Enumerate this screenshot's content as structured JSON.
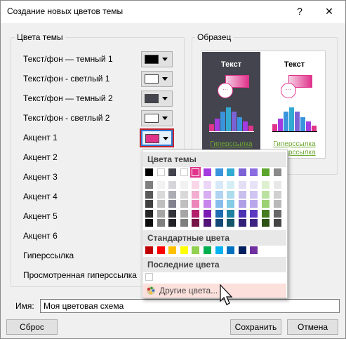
{
  "dialog": {
    "title": "Создание новых цветов темы",
    "help_label": "?",
    "close_label": "✕"
  },
  "theme_group": {
    "legend": "Цвета темы",
    "rows": [
      {
        "label": "Текст/фон — темный 1",
        "color": "#000000"
      },
      {
        "label": "Текст/фон - светлый 1",
        "color": "#ffffff"
      },
      {
        "label": "Текст/фон — темный 2",
        "color": "#44444f"
      },
      {
        "label": "Текст/фон - светлый 2",
        "color": "#ffffff"
      },
      {
        "label": "Акцент 1",
        "color": "#e0338c"
      },
      {
        "label": "Акцент 2",
        "color": null
      },
      {
        "label": "Акцент 3",
        "color": null
      },
      {
        "label": "Акцент 4",
        "color": null
      },
      {
        "label": "Акцент 5",
        "color": null
      },
      {
        "label": "Акцент 6",
        "color": null
      },
      {
        "label": "Гиперссылка",
        "color": null
      },
      {
        "label": "Просмотренная гиперссылка",
        "color": null
      }
    ]
  },
  "sample_group": {
    "legend": "Образец",
    "samples": [
      {
        "theme": "dark",
        "text": "Текст",
        "link": "Гиперссылка",
        "link2": "",
        "bg": "#44444f",
        "fg": "#ffffff"
      },
      {
        "theme": "light",
        "text": "Текст",
        "link": "Гиперссылка",
        "link2": "Гиперссылка",
        "bg": "#ffffff",
        "fg": "#000000"
      }
    ]
  },
  "color_menu": {
    "theme_header": "Цвета темы",
    "theme_top": [
      "#000000",
      "#ffffff",
      "#44444f",
      "#ffffff",
      "#e0338c",
      "#a33be0",
      "#3a94dd",
      "#32aad2",
      "#7b63d6",
      "#8a6de0",
      "#5ba52c",
      "#8a8a8a"
    ],
    "theme_shades": [
      [
        "#7f7f7f",
        "#f2f2f2",
        "#d6d6da",
        "#f2f2f2",
        "#f9d6e8",
        "#ecd6f8",
        "#d7e9f8",
        "#d6eef6",
        "#e4dff7",
        "#e8e2f8",
        "#ddf0d0",
        "#e8e8e8"
      ],
      [
        "#595959",
        "#d9d9d9",
        "#acacb5",
        "#d9d9d9",
        "#f2aed1",
        "#d9adf2",
        "#afd3f1",
        "#addced",
        "#c9bfef",
        "#d0c4f2",
        "#bbe1a1",
        "#d0d0d0"
      ],
      [
        "#3f3f3f",
        "#bfbfbf",
        "#82828f",
        "#bfbfbf",
        "#ec85ba",
        "#c784eb",
        "#87bdeb",
        "#84cbe4",
        "#ae9fe7",
        "#b9a7ec",
        "#99d173",
        "#b9b9b9"
      ],
      [
        "#262626",
        "#a5a5a5",
        "#33333b",
        "#a5a5a5",
        "#b21f6b",
        "#7c1bb4",
        "#1e6cb1",
        "#1f809f",
        "#4d32b3",
        "#5c38c2",
        "#447c1f",
        "#676767"
      ],
      [
        "#0c0c0c",
        "#7f7f7f",
        "#222227",
        "#7f7f7f",
        "#761447",
        "#521278",
        "#144876",
        "#14556a",
        "#332177",
        "#3d2581",
        "#2d5215",
        "#454545"
      ]
    ],
    "standard_header": "Стандартные цвета",
    "standard": [
      "#c00000",
      "#ff0000",
      "#ffc000",
      "#ffff00",
      "#92d050",
      "#00b050",
      "#00b0f0",
      "#0070c0",
      "#002060",
      "#7030a0"
    ],
    "recent_header": "Последние цвета",
    "recent": [
      "#ffffff"
    ],
    "more_label": "Другие цвета..."
  },
  "footer": {
    "name_label": "Имя:",
    "name_value": "Моя цветовая схема",
    "reset_label": "Сброс",
    "save_label": "Сохранить",
    "cancel_label": "Отмена"
  }
}
